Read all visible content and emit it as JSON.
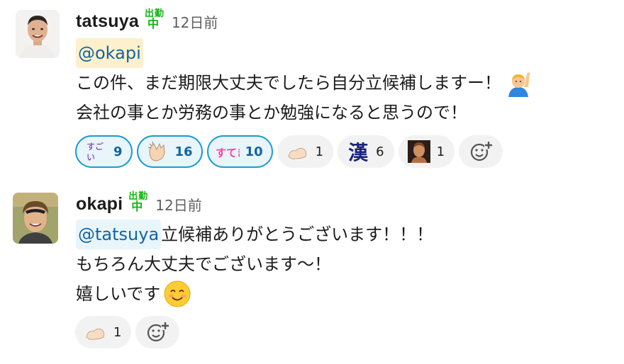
{
  "messages": [
    {
      "author": "tatsuya",
      "status_emoji": [
        "出",
        "勤",
        "中"
      ],
      "time": "12日前",
      "mention": "@okapi",
      "lines": [
        "この件、まだ期限大丈夫でしたら自分立候補しますー！",
        "会社の事とか労務の事とか勉強になると思うので！"
      ],
      "inline_emoji": "man-raising-hand-emoji",
      "reactions": [
        {
          "emoji": "sugoi-emoji",
          "text": "すごい",
          "count": "9",
          "mine": true
        },
        {
          "emoji": "clapping-hands-emoji",
          "count": "16",
          "mine": true
        },
        {
          "emoji": "suteki-emoji",
          "text": "すてき",
          "count": "10",
          "mine": true
        },
        {
          "emoji": "flexed-biceps-emoji",
          "count": "1",
          "mine": false
        },
        {
          "emoji": "kanji-emoji",
          "text": "漢",
          "count": "6",
          "mine": false
        },
        {
          "emoji": "portrait-emoji",
          "count": "1",
          "mine": false
        }
      ]
    },
    {
      "author": "okapi",
      "status_emoji": [
        "出",
        "勤",
        "中"
      ],
      "time": "12日前",
      "mention": "@tatsuya",
      "lines": [
        " 立候補ありがとうございます！！！",
        "もちろん大丈夫でございます〜！",
        "嬉しいです"
      ],
      "inline_emoji": "smiling-face-emoji",
      "reactions": [
        {
          "emoji": "flexed-biceps-emoji",
          "count": "1",
          "mine": false
        }
      ]
    }
  ],
  "colors": {
    "mention_text": "#1264a3",
    "mention_bg_1": "#fdf0cc",
    "mention_bg_2": "#e8f5fa",
    "reaction_mine_border": "#1d9bd1",
    "reaction_bg": "#f2f2f2",
    "status_green": "#15b315"
  }
}
